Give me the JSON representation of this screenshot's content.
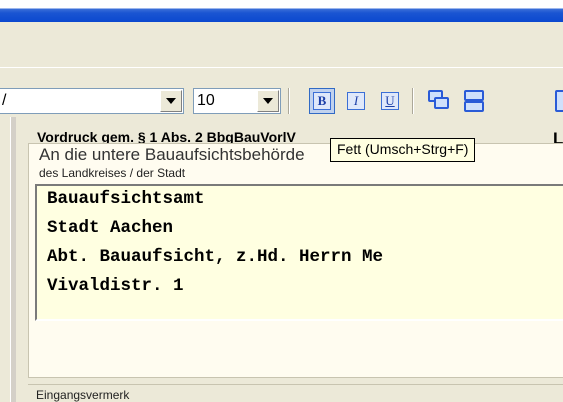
{
  "toolbar": {
    "font_name_value": "/",
    "font_size_value": "10",
    "bold_glyph": "B",
    "italic_glyph": "I",
    "underline_glyph": "U"
  },
  "form": {
    "heading": "Vordruck gem. § 1 Abs. 2 BbgBauVorlV",
    "heading_right": "La",
    "recipient_line1": "An die untere Bauaufsichtsbehörde",
    "recipient_line2": "des Landkreises / der Stadt",
    "address": [
      "Bauaufsichtsamt",
      "Stadt Aachen",
      "Abt. Bauaufsicht, z.Hd. Herrn Me",
      "Vivaldistr. 1"
    ],
    "footer_label": "Eingangsvermerk"
  },
  "tooltip": {
    "text": "Fett (Umsch+Strg+F)"
  }
}
